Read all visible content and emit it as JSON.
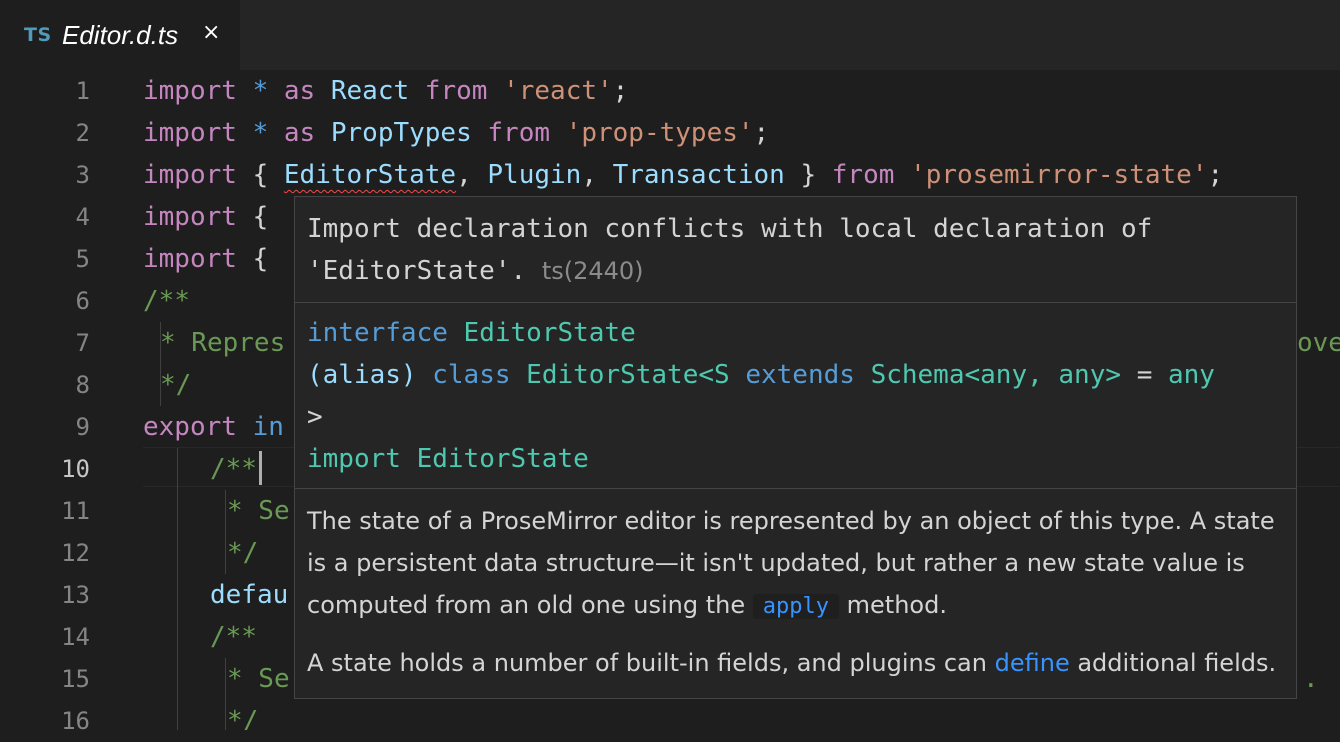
{
  "tab": {
    "icon_label": "TS",
    "title": "Editor.d.ts",
    "close_glyph": "×"
  },
  "gutter": {
    "line_numbers": [
      "1",
      "2",
      "3",
      "4",
      "5",
      "6",
      "7",
      "8",
      "9",
      "10",
      "11",
      "12",
      "13",
      "14",
      "15",
      "16"
    ],
    "active_line": "10"
  },
  "code": {
    "l1": {
      "import": "import",
      "star": "*",
      "as": "as",
      "name": "React",
      "from": "from",
      "module": "'react'",
      "semi": ";"
    },
    "l2": {
      "import": "import",
      "star": "*",
      "as": "as",
      "name": "PropTypes",
      "from": "from",
      "module": "'prop-types'",
      "semi": ";"
    },
    "l3": {
      "import": "import",
      "open": "{",
      "name1": "EditorState",
      "comma1": ",",
      "name2": "Plugin",
      "comma2": ",",
      "name3": "Transaction",
      "close": "}",
      "from": "from",
      "module": "'prosemirror-state'",
      "semi": ";"
    },
    "l4": {
      "import": "import",
      "open": "{"
    },
    "l5": {
      "import": "import",
      "open": "{"
    },
    "l6": {
      "text": "/**"
    },
    "l7": {
      "text": "* Repres",
      "right_fragment": "ove"
    },
    "l8": {
      "text": "*/"
    },
    "l9": {
      "export": "export",
      "rest": "in"
    },
    "l10": {
      "text": "/**"
    },
    "l11": {
      "text": "* Se"
    },
    "l12": {
      "text": "*/"
    },
    "l13": {
      "text": "defau"
    },
    "l14": {
      "text": "/**"
    },
    "l15": {
      "text": "* Se",
      "right_fragment": "."
    },
    "l16": {
      "text": "*/"
    }
  },
  "hover": {
    "error_message_line1": "Import declaration conflicts with local declaration of",
    "error_message_line2": "'EditorState'.",
    "error_source": "ts(2440)",
    "sig_interface_kw": "interface",
    "sig_interface_name": "EditorState",
    "sig_alias_prefix": "(alias)",
    "sig_class_kw": "class",
    "sig_class_name": "EditorState<S",
    "sig_extends_kw": "extends",
    "sig_schema": "Schema",
    "sig_generic_args": "<any, any>",
    "sig_eq": "=",
    "sig_any": "any",
    "sig_close": ">",
    "sig_import_kw": "import",
    "sig_import_name": "EditorState",
    "doc_p1_a": "The state of a ProseMirror editor is represented by an object of this type. A state is a persistent data structure—it isn't updated, but rather a new state value is computed from an old one using the",
    "doc_p1_code": "apply",
    "doc_p1_b": "method.",
    "doc_p2_a": "A state holds a number of built-in fields, and plugins can",
    "doc_p2_link": "define",
    "doc_p2_b": "additional",
    "doc_p2_c": "fields."
  },
  "colors": {
    "background": "#1e1e1e",
    "keyword": "#c586c0",
    "constant": "#569cd6",
    "variable": "#9cdcfe",
    "string": "#ce9178",
    "comment": "#6a9955",
    "type": "#4ec9b0",
    "link": "#3794ff",
    "error": "#f14c4c"
  }
}
